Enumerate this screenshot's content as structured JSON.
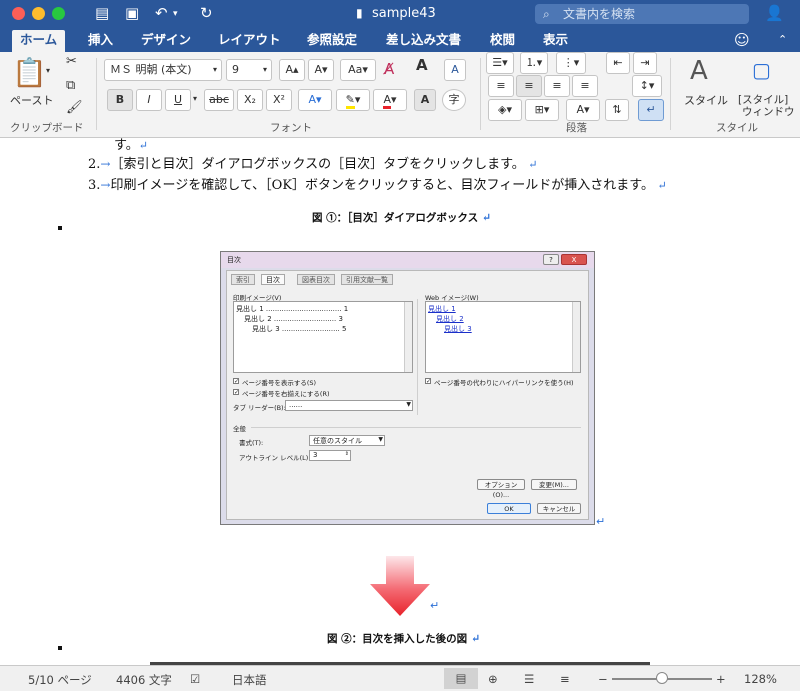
{
  "window": {
    "title": "sample43",
    "search_placeholder": "文書内を検索"
  },
  "tabs": [
    "ホーム",
    "挿入",
    "デザイン",
    "レイアウト",
    "参照設定",
    "差し込み文書",
    "校閲",
    "表示"
  ],
  "ribbon": {
    "clipboard": {
      "paste_label": "ペースト",
      "group_label": "クリップボード"
    },
    "font": {
      "font_name": "ＭＳ 明朝 (本文)",
      "font_size": "9",
      "bold": "B",
      "italic": "I",
      "underline": "U",
      "strike": "abc",
      "subscript": "X₂",
      "superscript": "X²",
      "group_label": "フォント"
    },
    "paragraph": {
      "group_label": "段落"
    },
    "styles": {
      "style_label": "スタイル",
      "pane_label_1": "[スタイル]",
      "pane_label_2": "ウィンドウ",
      "group_label": "スタイル"
    }
  },
  "document": {
    "line_su": "す。",
    "item2_num": "2.",
    "item2_text": "［索引と目次］ダイアログボックスの［目次］タブをクリックします。",
    "item3_num": "3.",
    "item3_text": "印刷イメージを確認して、［OK］ボタンをクリックすると、目次フィールドが挿入されます。",
    "caption1": "図 ①：［目次］ダイアログボックス",
    "caption2": "図 ②：目次を挿入した後の図"
  },
  "dialog": {
    "title": "目次",
    "help_btn": "?",
    "close_btn": "X",
    "tabs": [
      "索引",
      "目次",
      "図表目次",
      "引用文献一覧"
    ],
    "print_preview_label": "印刷イメージ(V)",
    "print_lines": [
      {
        "text": "見出し 1",
        "page": "1"
      },
      {
        "text": "見出し 2",
        "page": "3"
      },
      {
        "text": "見出し 3",
        "page": "5"
      }
    ],
    "web_preview_label": "Web イメージ(W)",
    "web_links": [
      "見出し 1",
      "見出し 2",
      "見出し 3"
    ],
    "show_page_numbers": "ページ番号を表示する(S)",
    "right_align": "ページ番号を右揃えにする(R)",
    "tab_leader_label": "タブ リーダー(B):",
    "tab_leader_value": "......",
    "hyperlinks": "ページ番号の代わりにハイパーリンクを使う(H)",
    "general_label": "全般",
    "format_label": "書式(T):",
    "format_value": "任意のスタイル",
    "outline_label": "アウトライン レベル(L):",
    "outline_value": "3",
    "options_btn": "オプション(O)...",
    "modify_btn": "変更(M)...",
    "ok_btn": "OK",
    "cancel_btn": "キャンセル"
  },
  "status": {
    "page": "5/10 ページ",
    "words": "4406 文字",
    "language": "日本語",
    "zoom": "128%"
  },
  "colors": {
    "titlebar": "#2b579a",
    "arrow_red": "#e8232b",
    "link_blue": "#1a2fc9"
  }
}
